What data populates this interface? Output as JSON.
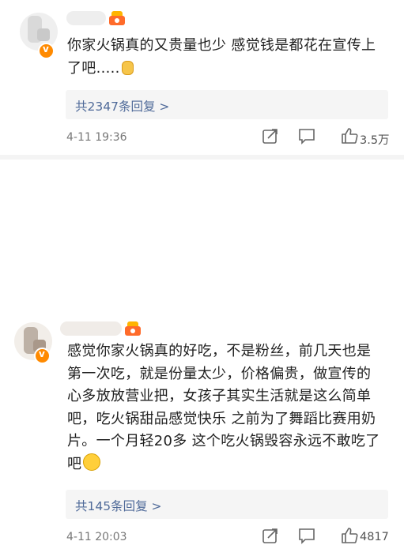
{
  "comments": [
    {
      "text_line1": "你家火锅真的又贵量也少 感觉钱是都花在宣传上",
      "text_line2": "了吧.....",
      "emoji": "sweat-emoji",
      "replies": "共2347条回复 >",
      "date": "4-11 19:36",
      "likes": "3.5万"
    },
    {
      "text_lines": [
        "感觉你家火锅真的好吃，不是粉丝，前几天也是",
        "第一次吃，就是份量太少，价格偏贵，做宣传的",
        "心多放放营业把，女孩子其实生活就是这么简单",
        "吧，吃火锅甜品感觉快乐 之前为了舞蹈比赛用奶",
        "片。一个月轻20多 这个吃火锅毁容永远不敢吃了",
        "吧"
      ],
      "emoji": "laugh-cry-emoji",
      "replies": "共145条回复 >",
      "date": "4-11 20:03",
      "likes": "4817"
    }
  ],
  "colors": {
    "accent": "#4f6a99",
    "badge": "#ff8a00",
    "crown": "#ff6b2a"
  }
}
